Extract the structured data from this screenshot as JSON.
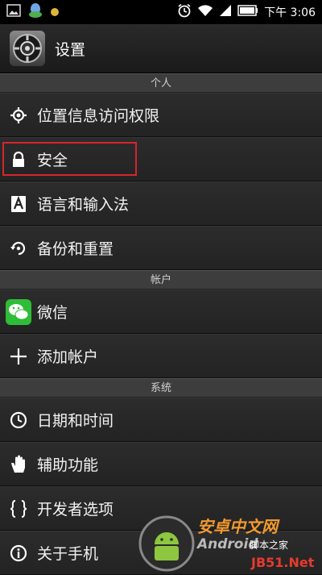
{
  "status_bar": {
    "time": "下午 3:06",
    "icons": [
      "image-icon",
      "qq-icon",
      "notification-dot-icon",
      "alarm-icon",
      "wifi-icon",
      "signal-icon",
      "battery-icon"
    ]
  },
  "header": {
    "title": "设置",
    "icon": "settings-gear-icon"
  },
  "sections": [
    {
      "header": "个人",
      "items": [
        {
          "label": "位置信息访问权限",
          "icon": "location-icon"
        },
        {
          "label": "安全",
          "icon": "lock-icon",
          "highlighted": true
        },
        {
          "label": "语言和输入法",
          "icon": "language-icon"
        },
        {
          "label": "备份和重置",
          "icon": "backup-icon"
        }
      ]
    },
    {
      "header": "帐户",
      "items": [
        {
          "label": "微信",
          "icon": "wechat-icon"
        },
        {
          "label": "添加帐户",
          "icon": "plus-icon"
        }
      ]
    },
    {
      "header": "系统",
      "items": [
        {
          "label": "日期和时间",
          "icon": "clock-icon"
        },
        {
          "label": "辅助功能",
          "icon": "hand-icon"
        },
        {
          "label": "开发者选项",
          "icon": "braces-icon"
        },
        {
          "label": "关于手机",
          "icon": "info-icon"
        }
      ]
    }
  ],
  "watermark": {
    "line1": "安卓中文网",
    "line2": "Android",
    "line3": "JB51.Net",
    "line4": "脚本之家"
  },
  "colors": {
    "highlight_border": "#d4262c",
    "section_bg": "#3d3d3d",
    "wechat_green": "#2fbd38"
  }
}
